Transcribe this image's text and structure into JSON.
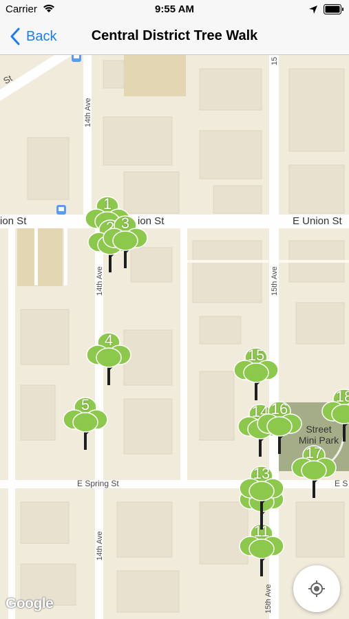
{
  "status_bar": {
    "carrier": "Carrier",
    "time": "9:55 AM"
  },
  "nav": {
    "back_label": "Back",
    "title": "Central District Tree Walk"
  },
  "map": {
    "streets": {
      "e_union_left": "ion St",
      "e_union_mid": "ion St",
      "e_union_right": "E Union St",
      "e_spring": "E Spring St",
      "e_spring_right": "E S",
      "ave14_top": "14th Ave",
      "ave14_mid": "14th Ave",
      "ave14_bottom": "14th Ave",
      "ave15_top": "15",
      "ave15_mid": "15th Ave",
      "ave15_bottom": "15th Ave",
      "diag_top": "St"
    },
    "park_label": "Street\nMini Park",
    "attribution": "Google",
    "markers": [
      "1",
      "2",
      "3",
      "4",
      "5",
      "11",
      "12",
      "13",
      "14",
      "15",
      "16",
      "17",
      "18"
    ]
  },
  "colors": {
    "tree": "#8cc84b",
    "trunk": "#1e1e1e",
    "accent": "#1a7cf5",
    "land": "#f1ebdc",
    "road": "#fefefe",
    "park": "#a4ad88"
  }
}
